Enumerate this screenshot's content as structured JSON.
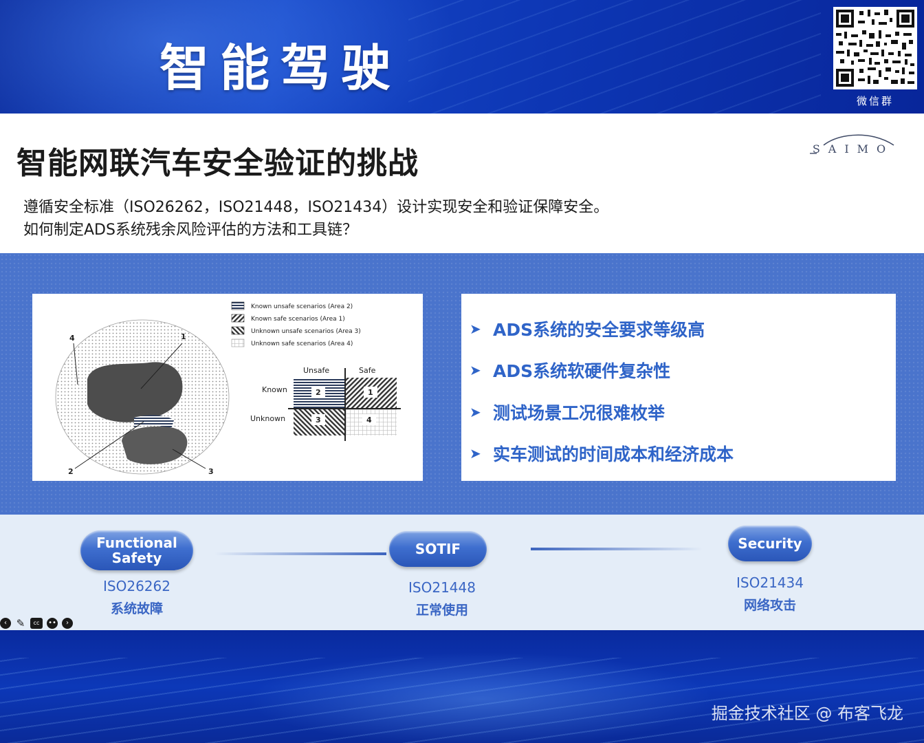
{
  "banner": {
    "title": "智能驾驶",
    "qr_caption": "微信群"
  },
  "header": {
    "heading": "智能网联汽车安全验证的挑战",
    "logo_text": "SAIMO",
    "intro_lines": [
      "遵循安全标准（ISO26262，ISO21448，ISO21434）设计实现安全和验证保障安全。",
      "如何制定ADS系统残余风险评估的方法和工具链？"
    ]
  },
  "figure": {
    "legend": [
      "Known unsafe scenarios (Area 2)",
      "Known safe scenarios (Area 1)",
      "Unknown unsafe scenarios (Area 3)",
      "Unknown safe scenarios (Area 4)"
    ],
    "matrix": {
      "col_unsafe": "Unsafe",
      "col_safe": "Safe",
      "row_known": "Known",
      "row_unknown": "Unknown",
      "cells": [
        "2",
        "1",
        "3",
        "4"
      ]
    },
    "area_labels": [
      "1",
      "2",
      "3",
      "4"
    ]
  },
  "bullets": [
    "ADS系统的安全要求等级高",
    "ADS系统软硬件复杂性",
    "测试场景工况很难枚举",
    "实车测试的时间成本和经济成本"
  ],
  "standards": [
    {
      "pill_line1": "Functional",
      "pill_line2": "Safety",
      "code": "ISO26262",
      "label": "系统故障"
    },
    {
      "pill_line1": "SOTIF",
      "pill_line2": "",
      "code": "ISO21448",
      "label": "正常使用"
    },
    {
      "pill_line1": "Security",
      "pill_line2": "",
      "code": "ISO21434",
      "label": "网络攻击"
    }
  ],
  "controls": [
    "prev-icon",
    "pen-icon",
    "cc-icon",
    "more-icon",
    "next-icon"
  ],
  "watermark": "掘金技术社区 @ 布客飞龙",
  "colors": {
    "accent": "#2f64c8",
    "band": "#4a74cc",
    "light_band": "#e4edf8"
  }
}
